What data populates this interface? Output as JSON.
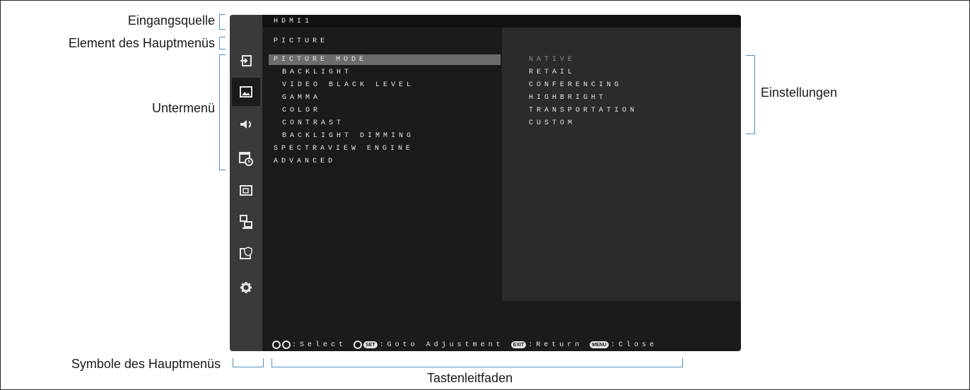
{
  "callouts": {
    "input_source": "Eingangsquelle",
    "main_menu_item": "Element des Hauptmenüs",
    "submenu": "Untermenü",
    "settings": "Einstellungen",
    "main_menu_icons": "Symbole des Hauptmenüs",
    "key_guide": "Tastenleitfaden"
  },
  "osd": {
    "input_source": "HDMI1",
    "main_menu_item": "PICTURE",
    "icons": [
      "input-icon",
      "picture-icon",
      "audio-icon",
      "schedule-icon",
      "multi-input-icon",
      "control-icon",
      "protect-icon",
      "system-icon"
    ],
    "submenu": [
      "PICTURE MODE",
      "BACKLIGHT",
      "VIDEO BLACK LEVEL",
      "GAMMA",
      "COLOR",
      "CONTRAST",
      "BACKLIGHT DIMMING",
      "SPECTRAVIEW ENGINE",
      "ADVANCED"
    ],
    "settings": [
      "NATIVE",
      "RETAIL",
      "CONFERENCING",
      "HIGHBRIGHT",
      "TRANSPORTATION",
      "CUSTOM"
    ],
    "guide": {
      "select": ":Select",
      "set_key": "SET",
      "goto": ":Goto Adjustment",
      "exit_key": "EXIT",
      "return": ":Return",
      "menu_key": "MENU",
      "close": ":Close"
    }
  },
  "colors": {
    "osd_background": "#1b1b1b",
    "iconbar": "#3a3a3a",
    "highlight": "#6c6c6c",
    "bracket": "#4f8fc0"
  }
}
